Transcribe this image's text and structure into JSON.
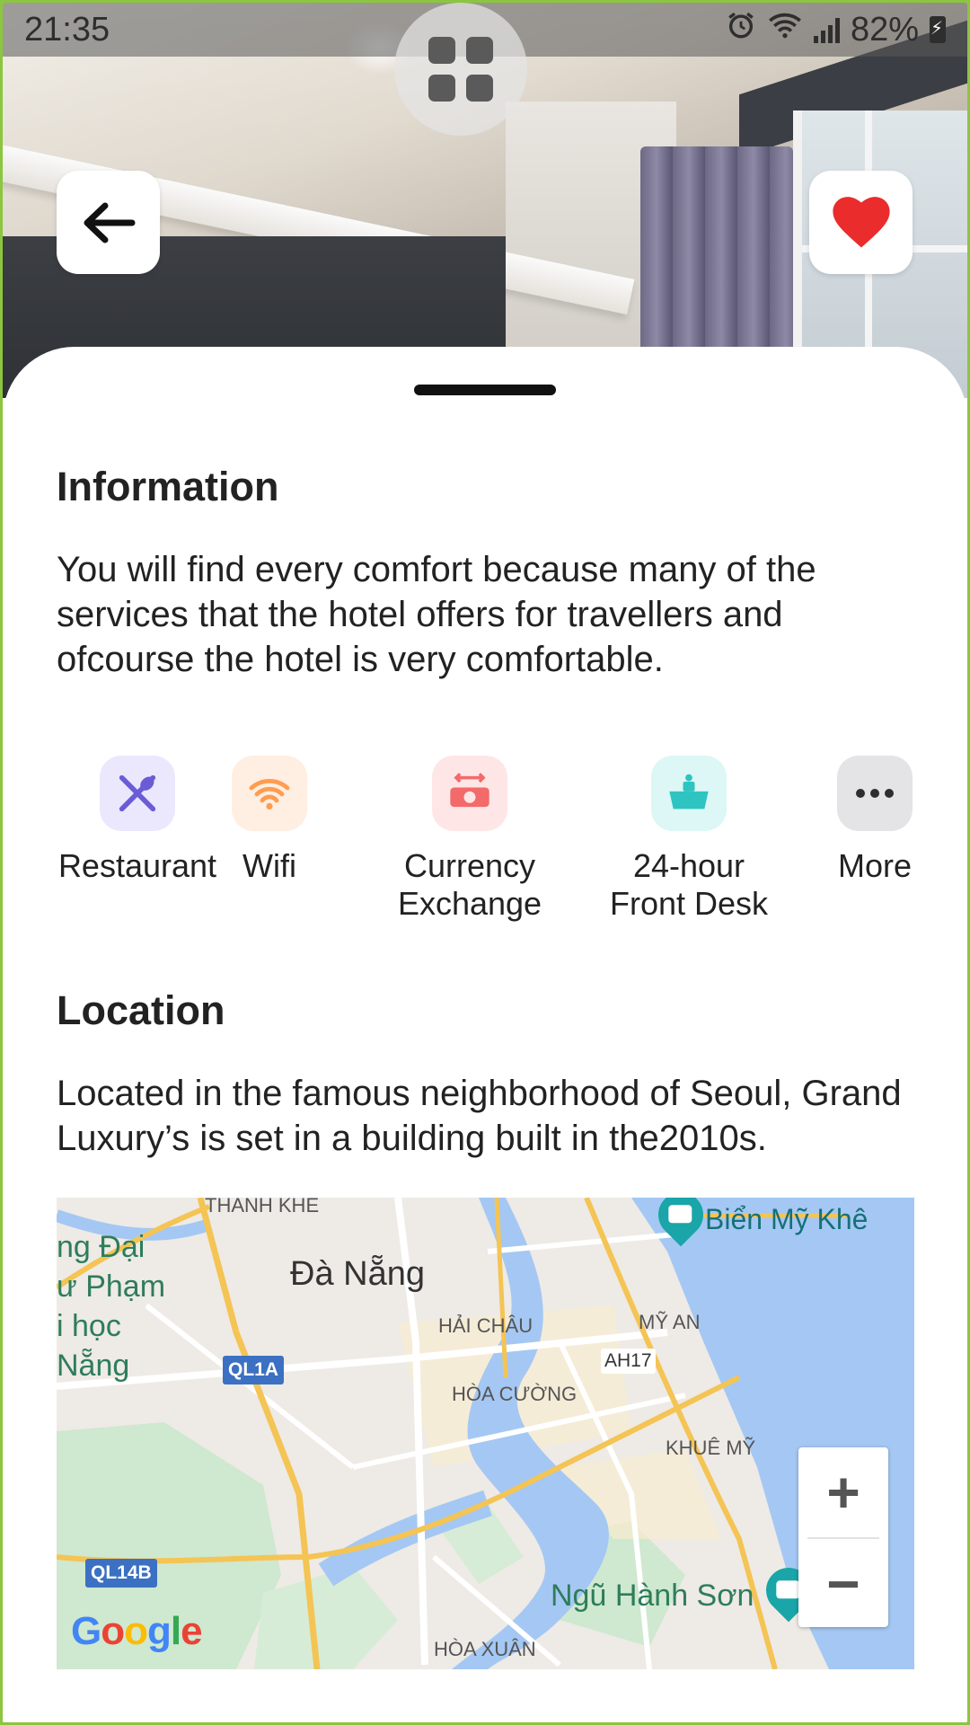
{
  "status_bar": {
    "time": "21:35",
    "battery": "82%"
  },
  "hero": {
    "back_icon": "arrow-left-icon",
    "favorite_icon": "heart-icon",
    "favorite_color": "#ea2c2c"
  },
  "information": {
    "title": "Information",
    "description": "You will find every comfort because many of the services that the hotel offers for travellers and ofcourse the hotel is very comfortable."
  },
  "amenities": [
    {
      "label": "Restaurant",
      "icon": "fork-spoon-icon",
      "color": "#ebe8fd",
      "icon_color": "#6a5cd6"
    },
    {
      "label": "Wifi",
      "icon": "wifi-icon",
      "color": "#ffeee2",
      "icon_color": "#ff9c4f"
    },
    {
      "label": "Currency\nExchange",
      "icon": "currency-exchange-icon",
      "color": "#ffe6e6",
      "icon_color": "#f26a6a"
    },
    {
      "label": "24-hour\nFront Desk",
      "icon": "front-desk-icon",
      "color": "#dcf7f5",
      "icon_color": "#2ec4c1"
    },
    {
      "label": "More",
      "icon": "more-icon",
      "color": "#e4e4e6",
      "icon_color": "#2e2e2e"
    }
  ],
  "location": {
    "title": "Location",
    "description": "Located in the famous neighborhood of Seoul, Grand Luxury’s is set in a building built in the2010s."
  },
  "map": {
    "labels": {
      "thanh_khe": "THANH KHE",
      "da_nang": "Đà Nẵng",
      "hai_chau": "HẢI CHÂU",
      "my_an": "MỸ AN",
      "hoa_cuong": "HÒA CƯỜNG",
      "khue_my": "KHUÊ MỸ",
      "hoa_xuan": "HÒA XUÂN",
      "bien_my_khe": "Biển Mỹ Khê",
      "ngu_hanh_son": "Ngũ Hành Sơn",
      "left_1": "ng Đại",
      "left_2": "ư Phạm",
      "left_3": "i học",
      "left_4": "Nẵng"
    },
    "badges": {
      "ql1a": "QL1A",
      "ql14b": "QL14B",
      "ah17": "AH17"
    },
    "google": [
      "G",
      "o",
      "o",
      "g",
      "l",
      "e"
    ],
    "zoom_in": "+",
    "zoom_out": "−"
  }
}
